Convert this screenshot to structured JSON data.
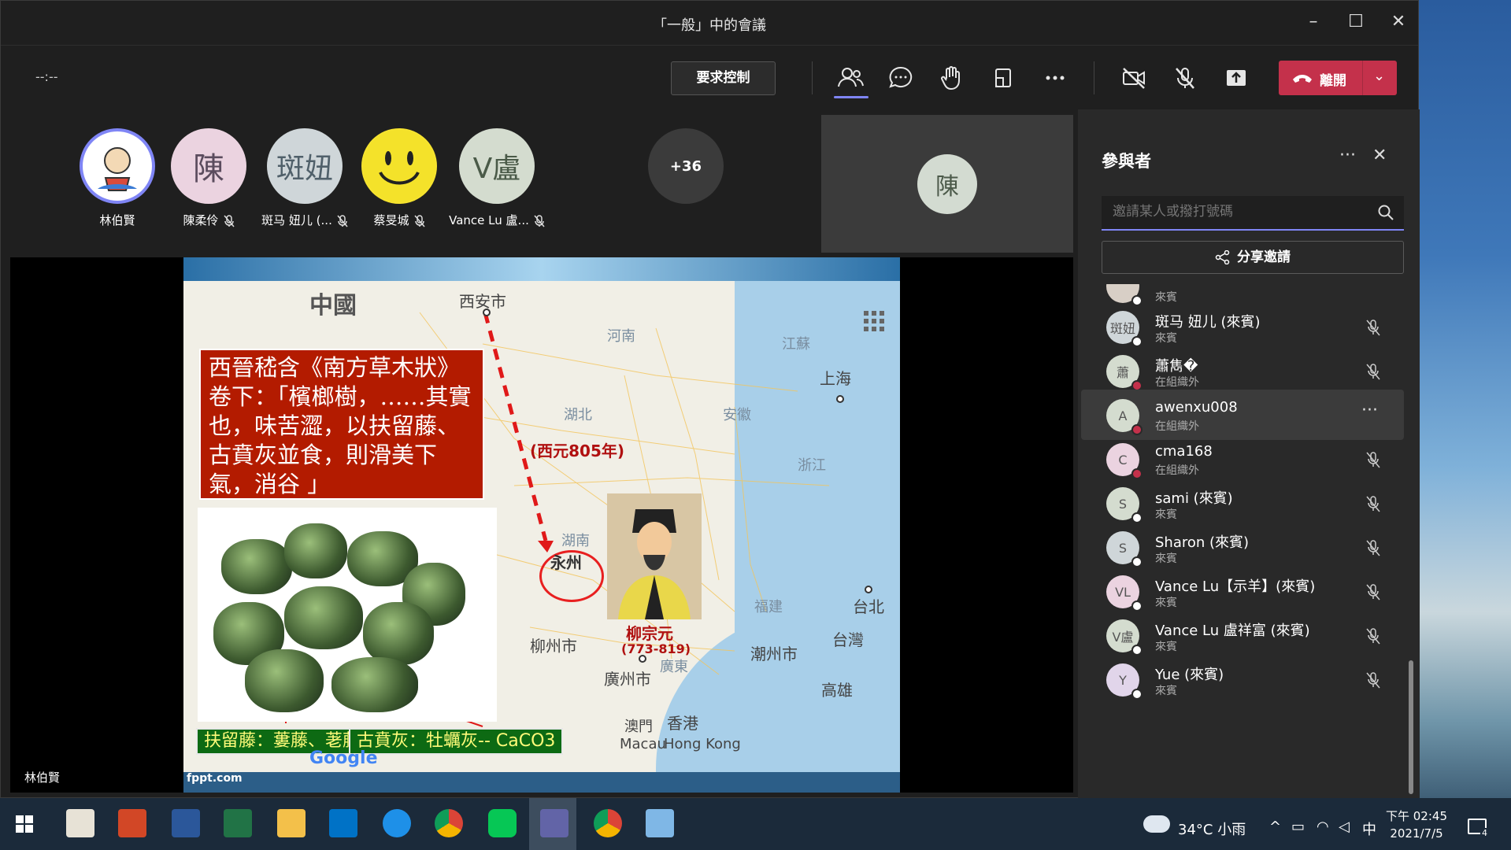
{
  "window": {
    "title": "「一般」中的會議"
  },
  "toolbar": {
    "timer": "--:--",
    "request_control": "要求控制",
    "leave": "離開"
  },
  "strip": {
    "people": [
      {
        "name": "林伯賢",
        "initials": "",
        "muted": false
      },
      {
        "name": "陳柔伶",
        "initials": "陳",
        "muted": true
      },
      {
        "name": "斑马 妞儿 (...",
        "initials": "斑妞",
        "muted": true
      },
      {
        "name": "蔡旻城",
        "initials": "",
        "muted": true
      },
      {
        "name": "Vance Lu 盧...",
        "initials": "V盧",
        "muted": true
      }
    ],
    "overflow": "+36"
  },
  "selfview": {
    "initials": "陳"
  },
  "slide": {
    "map_labels": {
      "china": "中國",
      "xian": "西安市",
      "henan": "河南",
      "jiangsu": "江蘇",
      "shanghai": "上海",
      "hubei": "湖北",
      "anhui": "安徽",
      "zhejiang": "浙江",
      "hunan": "湖南",
      "fujian": "福建",
      "taibei": "台北",
      "taiwan": "台灣",
      "gaoxiong": "高雄",
      "guangdong": "廣東",
      "liuzhou": "柳州市",
      "chaozhou": "潮州市",
      "guangzhou": "廣州市",
      "macau_zh": "澳門",
      "hk_zh": "香港",
      "macau_en": "Macau",
      "hk_en": "Hong Kong",
      "year": "(西元805年)",
      "yongzhou": "永州",
      "person": "柳宗元",
      "person_years": "(773-819)"
    },
    "quote": "西晉嵇含《南方草木狀》卷下：「檳榔樹，……其實也，味苦澀，以扶留藤、古賁灰並食，則滑美下氣，消谷 」",
    "caption_left": "扶留藤：蔞藤、荖藤",
    "caption_right": "古賁灰：牡蠣灰-- CaCO3",
    "google": "Google",
    "footer": "fppt.com"
  },
  "stage": {
    "presenter": "林伯賢"
  },
  "panel": {
    "title": "參與者",
    "search_placeholder": "邀請某人或撥打號碼",
    "share": "分享邀請",
    "rows": [
      {
        "name": "",
        "sub": "來賓",
        "initials": "",
        "status": "#ffffff",
        "muted": false
      },
      {
        "name": "斑马 妞儿 (來賓)",
        "sub": "來賓",
        "initials": "斑妞",
        "status": "#ffffff",
        "muted": true
      },
      {
        "name": "蕭雋�",
        "sub": "在組織外",
        "initials": "蕭",
        "status": "#c4314b",
        "muted": true
      },
      {
        "name": "awenxu008",
        "sub": "在組織外",
        "initials": "A",
        "status": "#c4314b",
        "muted": false
      },
      {
        "name": "cma168",
        "sub": "在組織外",
        "initials": "C",
        "status": "#c4314b",
        "muted": true
      },
      {
        "name": "sami (來賓)",
        "sub": "來賓",
        "initials": "S",
        "status": "#ffffff",
        "muted": true
      },
      {
        "name": "Sharon (來賓)",
        "sub": "來賓",
        "initials": "S",
        "status": "#ffffff",
        "muted": true
      },
      {
        "name": "Vance Lu【示羊】(來賓)",
        "sub": "來賓",
        "initials": "VL",
        "status": "#ffffff",
        "muted": true
      },
      {
        "name": "Vance Lu 盧祥富 (來賓)",
        "sub": "來賓",
        "initials": "V盧",
        "status": "#ffffff",
        "muted": true
      },
      {
        "name": "Yue (來賓)",
        "sub": "來賓",
        "initials": "Y",
        "status": "#ffffff",
        "muted": true
      }
    ]
  },
  "taskbar": {
    "weather": "34°C 小雨",
    "ime": "中",
    "time": "下午 02:45",
    "date": "2021/7/5",
    "notif_count": "4"
  },
  "colors": {
    "accent": "#7f85f5",
    "leave": "#c4314b",
    "panel": "#292929"
  }
}
